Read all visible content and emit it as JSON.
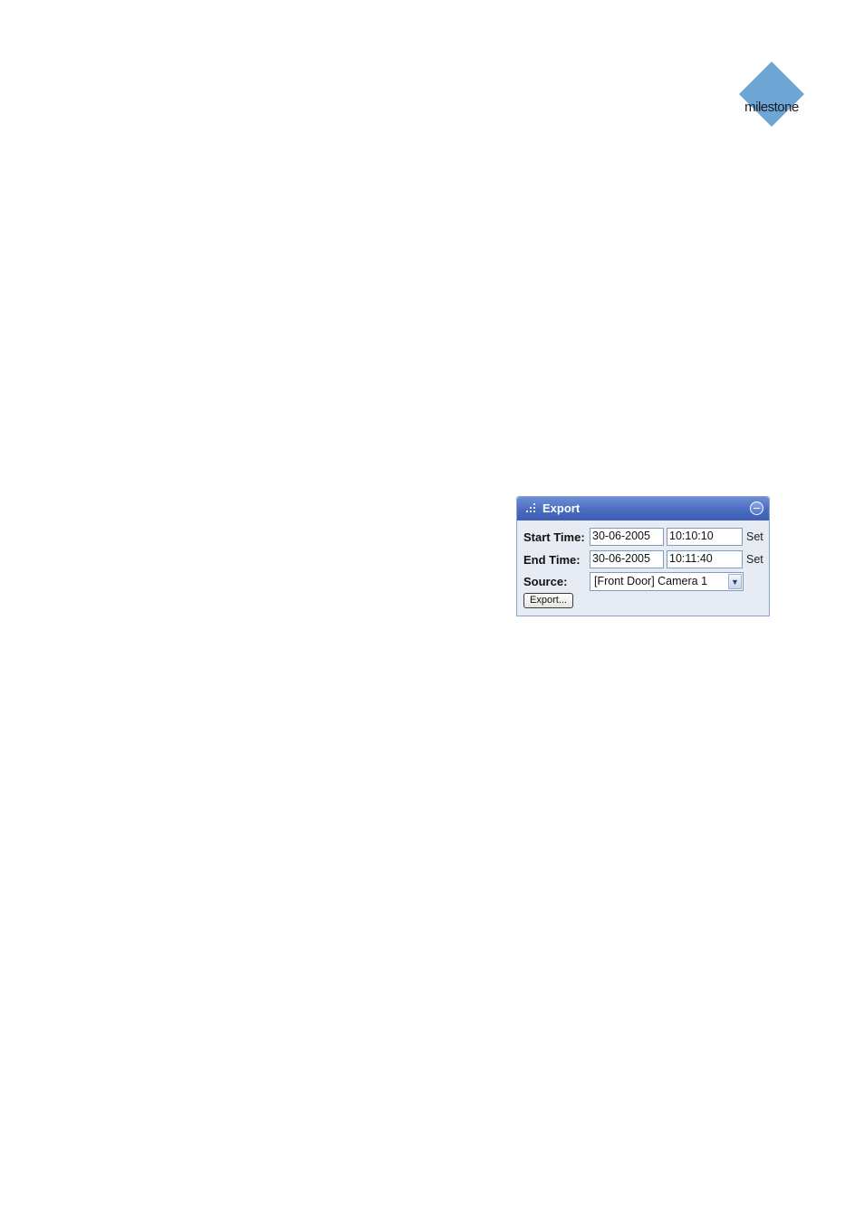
{
  "logo": {
    "text": "milestone",
    "icon": "diamond-logo-icon",
    "color": "#6ea6d6"
  },
  "export_panel": {
    "title": "Export",
    "collapse_icon": "collapse-icon",
    "start_time": {
      "label": "Start Time:",
      "date": "30-06-2005",
      "time": "10:10:10",
      "set_label": "Set"
    },
    "end_time": {
      "label": "End Time:",
      "date": "30-06-2005",
      "time": "10:11:40",
      "set_label": "Set"
    },
    "source": {
      "label": "Source:",
      "value": "[Front Door] Camera 1"
    },
    "export_button": "Export...",
    "colors": {
      "header": "#4a6cc1",
      "body": "#e7ebf4",
      "border": "#8aa3cc"
    }
  }
}
